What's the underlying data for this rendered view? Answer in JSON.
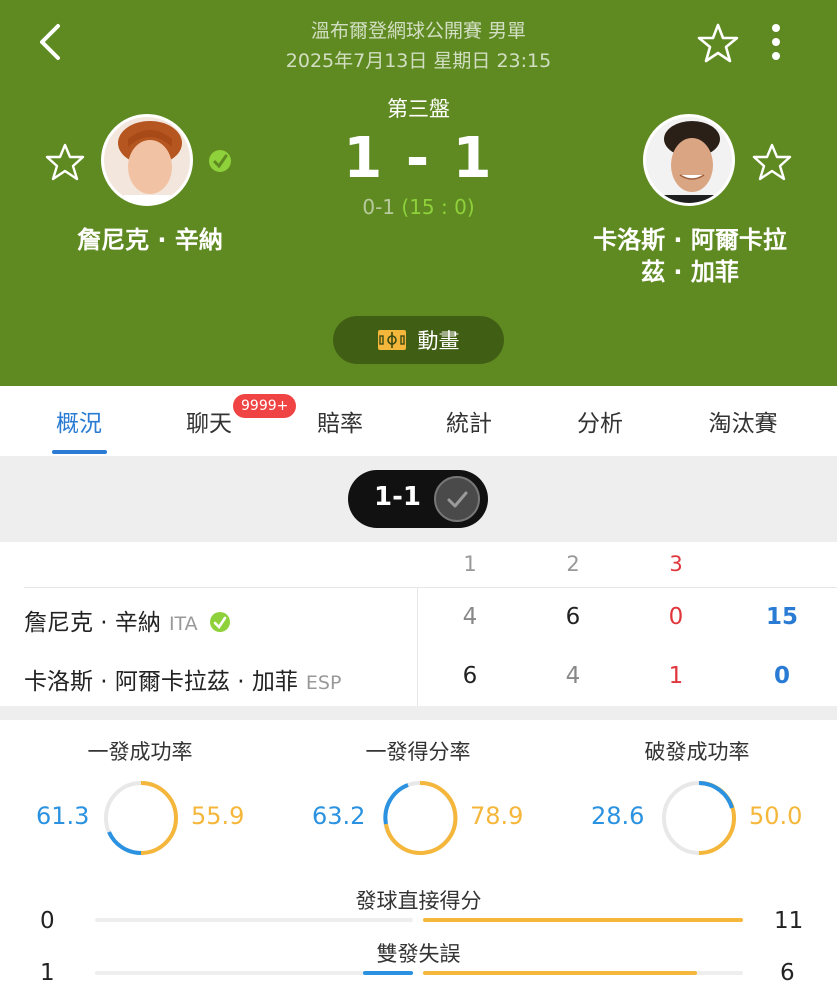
{
  "header": {
    "competition": "溫布爾登網球公開賽 男單",
    "datetime": "2025年7月13日 星期日 23:15",
    "set_label": "第三盤",
    "score": "1 - 1",
    "game_score": "0-1",
    "point_score": "(15 : 0)",
    "player_left": "詹尼克 · 辛納",
    "player_right_line1": "卡洛斯 · 阿爾卡拉",
    "player_right_line2": "茲 · 加菲",
    "animation_label": "動畫",
    "accent": "#5f8a22"
  },
  "tabs": {
    "items": [
      "概況",
      "聊天",
      "賠率",
      "統計",
      "分析",
      "淘汰賽"
    ],
    "active": "概況",
    "chat_badge": "9999+"
  },
  "sets_pill": "1-1",
  "score_table": {
    "headers": [
      "1",
      "2",
      "3"
    ],
    "rows": [
      {
        "name": "詹尼克 · 辛納",
        "country": "ITA",
        "s1": "4",
        "s2": "6",
        "s3": "0",
        "points": "15"
      },
      {
        "name": "卡洛斯 · 阿爾卡拉茲 · 加菲",
        "country": "ESP",
        "s1": "6",
        "s2": "4",
        "s3": "1",
        "points": "0"
      }
    ]
  },
  "stats": [
    {
      "title": "一發成功率",
      "left": "61.3",
      "right": "55.9"
    },
    {
      "title": "一發得分率",
      "left": "63.2",
      "right": "78.9"
    },
    {
      "title": "破發成功率",
      "left": "28.6",
      "right": "50.0"
    }
  ],
  "bars": [
    {
      "title": "發球直接得分",
      "left": "0",
      "right": "11"
    },
    {
      "title": "雙發失誤",
      "left": "1",
      "right": "6"
    }
  ],
  "colors": {
    "blue": "#2a92e0",
    "orange": "#f5b73b",
    "red": "#e0353b"
  }
}
